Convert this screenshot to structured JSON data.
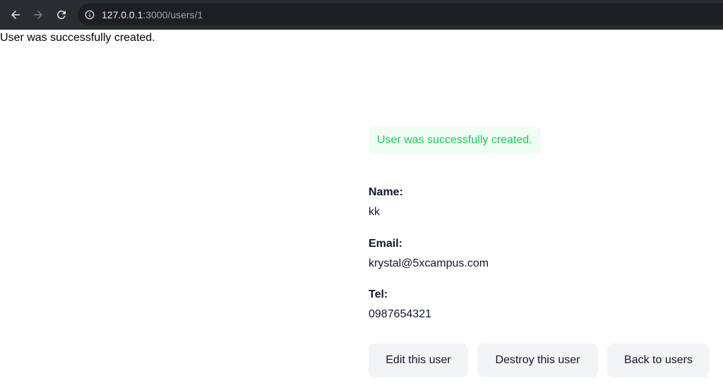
{
  "browser": {
    "url_host": "127.0.0.1",
    "url_rest": ":3000/users/1",
    "icons": [
      "back-arrow-icon",
      "forward-arrow-icon",
      "reload-icon",
      "info-icon"
    ]
  },
  "notice": "User was successfully created.",
  "flash": {
    "text": "User was successfully created.",
    "text_color": "#22c55e",
    "background": "#f0fdf4"
  },
  "user": {
    "name_label": "Name:",
    "name_value": "kk",
    "email_label": "Email:",
    "email_value": "krystal@5xcampus.com",
    "tel_label": "Tel:",
    "tel_value": "0987654321"
  },
  "actions": {
    "edit_label": "Edit this user",
    "destroy_label": "Destroy this user",
    "back_label": "Back to users"
  }
}
